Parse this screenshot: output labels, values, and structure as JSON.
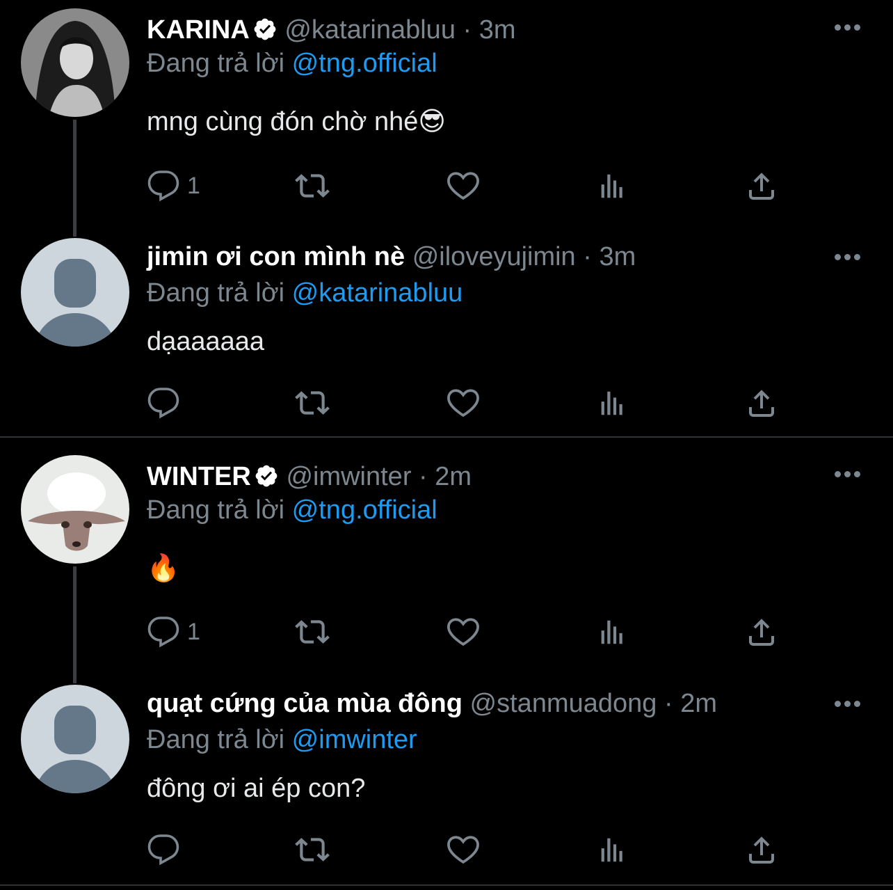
{
  "colors": {
    "background": "#000000",
    "accent": "#1d9bf0",
    "muted": "#7d8790",
    "divider": "#2f3336"
  },
  "reply_prefix": "Đang trả lời",
  "tweets": [
    {
      "name": "KARINA",
      "verified": true,
      "handle": "@katarinabluu",
      "time": "3m",
      "reply_to": "@tng.official",
      "text": "mng cùng đón chờ nhé😎",
      "replies": "1"
    },
    {
      "name": "jimin ơi con mình nè",
      "verified": false,
      "handle": "@iloveyujimin",
      "time": "3m",
      "reply_to": "@katarinabluu",
      "text": "dạaaaaaa",
      "replies": ""
    },
    {
      "name": "WINTER",
      "verified": true,
      "handle": "@imwinter",
      "time": "2m",
      "reply_to": "@tng.official",
      "text": "🔥",
      "replies": "1"
    },
    {
      "name": "quạt cứng của mùa đông",
      "verified": false,
      "handle": "@stanmuadong",
      "time": "2m",
      "reply_to": "@imwinter",
      "text": "đông ơi ai ép con?",
      "replies": ""
    }
  ],
  "icons": {
    "reply": "reply-icon",
    "retweet": "retweet-icon",
    "like": "heart-icon",
    "views": "views-icon",
    "share": "share-icon",
    "more": "more-icon",
    "verified": "verified-badge-icon"
  }
}
